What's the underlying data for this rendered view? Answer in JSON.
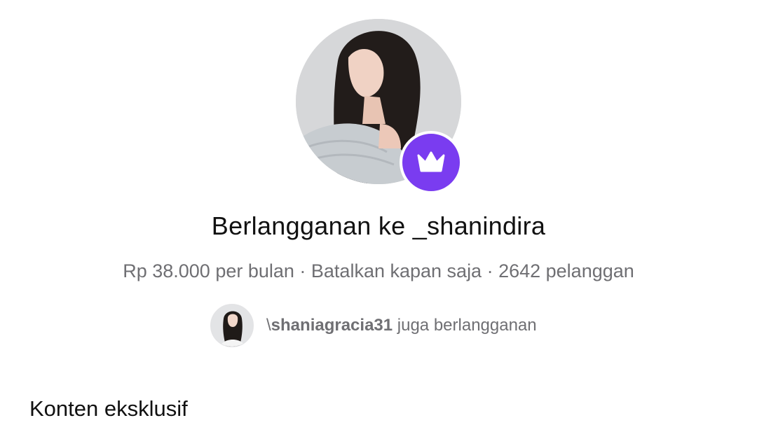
{
  "creator": {
    "title": "Berlangganan ke _shanindira",
    "avatar_alt": "avatar",
    "badge_icon": "crown-icon",
    "badge_color": "#7a3cf0"
  },
  "subscription": {
    "price": "Rp 38.000 per bulan",
    "separator": " · ",
    "cancel_text": "Batalkan kapan saja",
    "subscribers": "2642 pelanggan"
  },
  "also_subscribed": {
    "prefix": "\\",
    "username": "shaniagracia31",
    "suffix": " juga berlangganan"
  },
  "sections": {
    "exclusive_title": "Konten eksklusif"
  }
}
